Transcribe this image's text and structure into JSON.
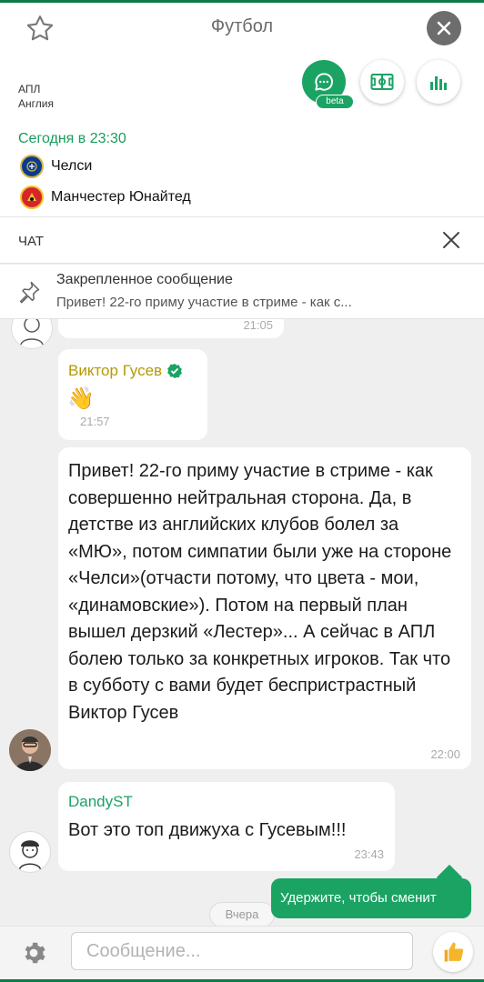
{
  "header": {
    "title": "Футбол",
    "league": "АПЛ",
    "country": "Англия",
    "beta_badge": "beta"
  },
  "match": {
    "time": "Сегодня в 23:30",
    "home_team": "Челси",
    "away_team": "Манчестер Юнайтед"
  },
  "chat": {
    "header_label": "ЧАТ",
    "pinned": {
      "title": "Закрепленное сообщение",
      "text": "Привет! 22-го приму участие в стриме - как с..."
    },
    "messages": [
      {
        "time": "21:05"
      },
      {
        "author": "Виктор Гусев",
        "text": "👋",
        "time": "21:57"
      },
      {
        "text": "Привет! 22-го приму участие в стриме - как совершенно нейтральная сторона. Да, в детстве из английских клубов болел за «МЮ», потом симпатии были уже на стороне «Челси»(отчасти потому, что цвета - мои, «динамовские»). Потом на первый план вышел дерзкий «Лестер»... А сейчас в АПЛ болею только за конкретных игроков. Так что в субботу с вами будет беспристрастный Виктор Гусев",
        "time": "22:00"
      },
      {
        "author": "DandyST",
        "text": "Вот это топ движуха с Гусевым!!!",
        "time": "23:43"
      }
    ],
    "date_chip": "Вчера",
    "tooltip": "Удержите, чтобы сменит",
    "input_placeholder": "Сообщение..."
  },
  "colors": {
    "accent": "#1ba364",
    "dark_green": "#0f7a44",
    "author_gold": "#b59a00",
    "author_green": "#1ba364"
  }
}
